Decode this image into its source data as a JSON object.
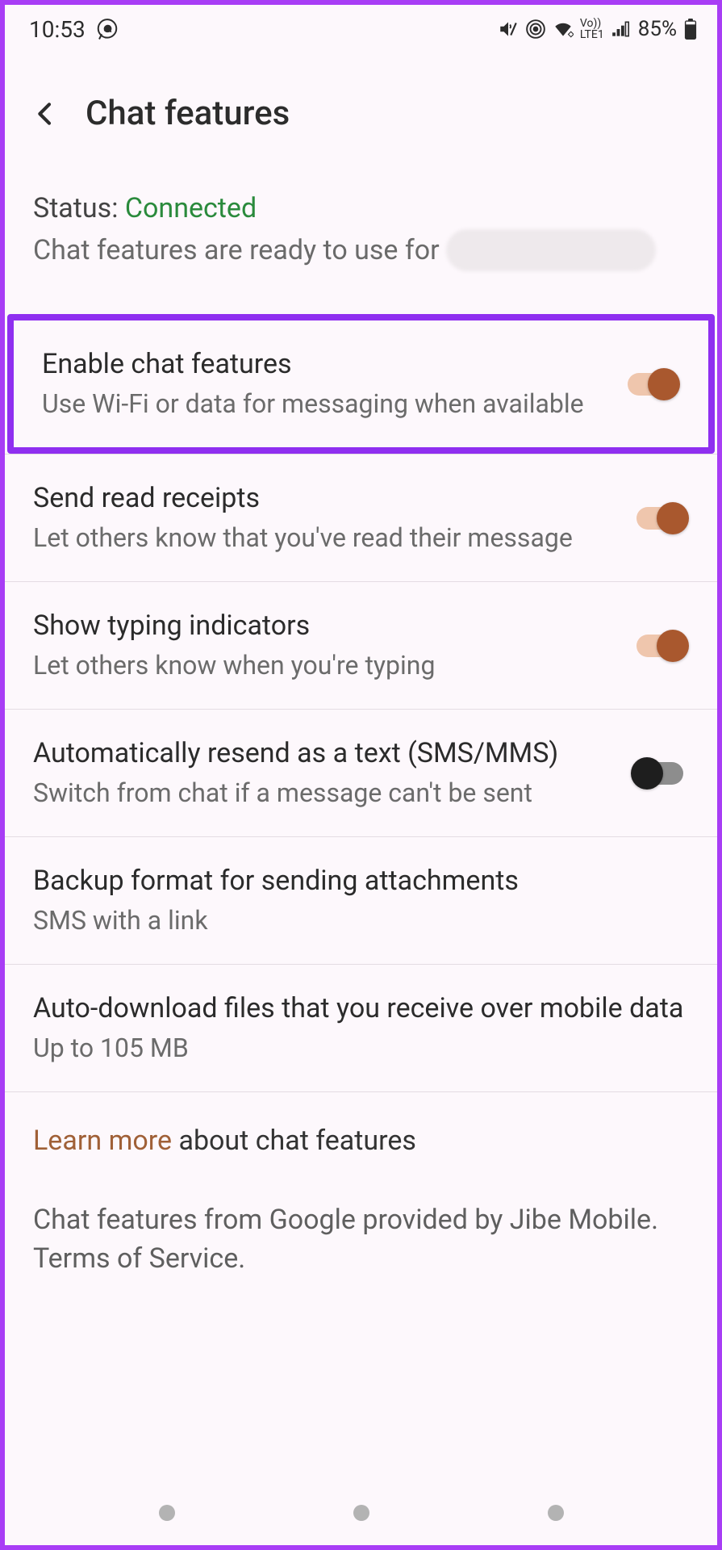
{
  "statusbar": {
    "time": "10:53",
    "battery": "85%",
    "network_small_top": "Vo))",
    "network_small_bot": "LTE1"
  },
  "header": {
    "title": "Chat features"
  },
  "status": {
    "label": "Status: ",
    "value": "Connected",
    "subtitle_prefix": "Chat features are ready to use for "
  },
  "items": {
    "enable": {
      "title": "Enable chat features",
      "sub": "Use Wi-Fi or data for messaging when available"
    },
    "readreceipts": {
      "title": "Send read receipts",
      "sub": "Let others know that you've read their message"
    },
    "typing": {
      "title": "Show typing indicators",
      "sub": "Let others know when you're typing"
    },
    "autoresend": {
      "title": "Automatically resend as a text (SMS/MMS)",
      "sub": "Switch from chat if a message can't be sent"
    },
    "backup": {
      "title": "Backup format for sending attachments",
      "sub": "SMS with a link"
    },
    "autodownload": {
      "title": "Auto-download files that you receive over mobile data",
      "sub": "Up to 105 MB"
    }
  },
  "footer": {
    "learn_link": "Learn more",
    "learn_rest": " about chat features",
    "provider": "Chat features from Google provided by Jibe Mobile. Terms of Service."
  }
}
